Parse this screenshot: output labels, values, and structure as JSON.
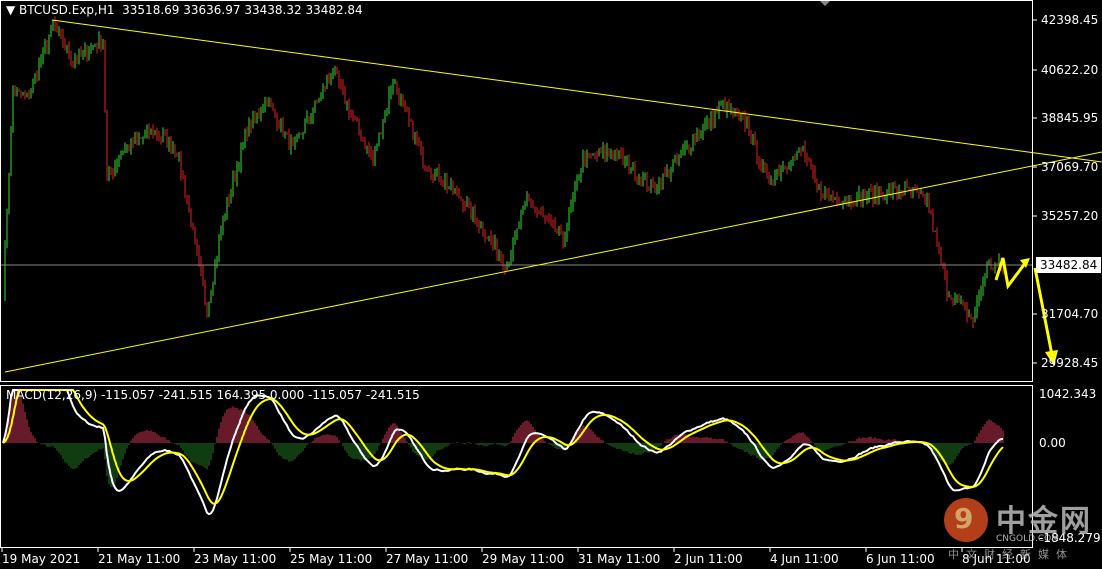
{
  "header": {
    "symbol": "BTCUSD.Exp,H1",
    "open": "33518.69",
    "high": "33636.97",
    "low": "33438.32",
    "close": "33482.84"
  },
  "macd_header": {
    "label": "MACD(12,26,9) -115.057 -241.515 164.395 0.000 -115.057 -241.515"
  },
  "price_axis": [
    "42398.45",
    "40622.20",
    "38845.95",
    "37069.70",
    "35257.20",
    "31704.70",
    "29928.45"
  ],
  "current_price": "33482.84",
  "macd_axis": [
    "1042.343",
    "0.00",
    "-1848.279"
  ],
  "time_axis": [
    "19 May 2021",
    "21 May 11:00",
    "23 May 11:00",
    "25 May 11:00",
    "27 May 11:00",
    "29 May 11:00",
    "31 May 11:00",
    "2 Jun 11:00",
    "4 Jun 11:00",
    "6 Jun 11:00",
    "8 Jun 11:00"
  ],
  "colors": {
    "up": "#33dd33",
    "down": "#dd2222",
    "trend": "#ffff00",
    "macd": "#ffffff",
    "signal": "#ffff00",
    "hist_pos": "#cc3355",
    "hist_neg": "#227722"
  },
  "watermark": {
    "name": "中金网",
    "site": "CNGOLD.COM",
    "tagline": "中文财经新媒体"
  },
  "chart_data": {
    "type": "candlestick",
    "timeframe": "H1",
    "price_range": [
      29928.45,
      42398.45
    ],
    "macd_range": [
      -1848.279,
      1042.343
    ],
    "price_path": [
      [
        0,
        32580
      ],
      [
        5,
        39853
      ],
      [
        12,
        39490
      ],
      [
        25,
        42216
      ],
      [
        35,
        40944
      ],
      [
        50,
        41671
      ],
      [
        52,
        36580
      ],
      [
        60,
        37672
      ],
      [
        75,
        38399
      ],
      [
        87,
        37672
      ],
      [
        92,
        35853
      ],
      [
        102,
        31854
      ],
      [
        110,
        35126
      ],
      [
        122,
        38399
      ],
      [
        132,
        39490
      ],
      [
        145,
        37672
      ],
      [
        165,
        40580
      ],
      [
        175,
        38762
      ],
      [
        185,
        37308
      ],
      [
        195,
        40216
      ],
      [
        210,
        37308
      ],
      [
        230,
        35853
      ],
      [
        252,
        33490
      ],
      [
        262,
        35853
      ],
      [
        280,
        34399
      ],
      [
        290,
        37308
      ],
      [
        305,
        37672
      ],
      [
        325,
        36217
      ],
      [
        345,
        38035
      ],
      [
        360,
        39308
      ],
      [
        372,
        38580
      ],
      [
        382,
        36580
      ],
      [
        400,
        37672
      ],
      [
        407,
        36217
      ],
      [
        420,
        35853
      ],
      [
        450,
        36217
      ],
      [
        462,
        35853
      ],
      [
        472,
        32580
      ],
      [
        485,
        31490
      ],
      [
        492,
        33490
      ],
      [
        500,
        33482.84
      ]
    ]
  }
}
